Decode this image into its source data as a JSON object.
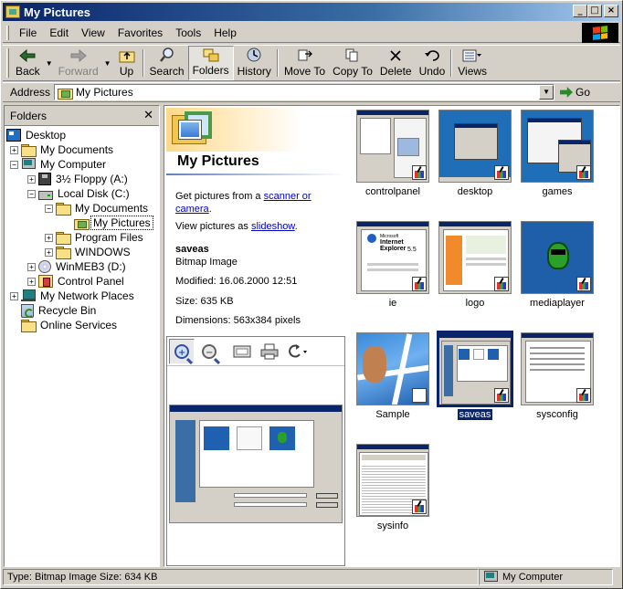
{
  "window": {
    "title": "My Pictures"
  },
  "menu": [
    "File",
    "Edit",
    "View",
    "Favorites",
    "Tools",
    "Help"
  ],
  "toolbar": {
    "back": "Back",
    "forward": "Forward",
    "up": "Up",
    "search": "Search",
    "folders": "Folders",
    "history": "History",
    "move_to": "Move To",
    "copy_to": "Copy To",
    "delete": "Delete",
    "undo": "Undo",
    "views": "Views"
  },
  "address": {
    "label": "Address",
    "value": "My Pictures",
    "go": "Go"
  },
  "folders_pane": {
    "title": "Folders",
    "tree": [
      {
        "label": "Desktop",
        "icon": "desktop-icon"
      },
      {
        "label": "My Documents",
        "icon": "folder-icon"
      },
      {
        "label": "My Computer",
        "icon": "computer-icon"
      },
      {
        "label": "3½ Floppy (A:)",
        "icon": "floppy-icon"
      },
      {
        "label": "Local Disk (C:)",
        "icon": "disk-icon"
      },
      {
        "label": "My Documents",
        "icon": "folder-icon"
      },
      {
        "label": "My Pictures",
        "icon": "pictures-folder-icon"
      },
      {
        "label": "Program Files",
        "icon": "folder-icon"
      },
      {
        "label": "WINDOWS",
        "icon": "folder-icon"
      },
      {
        "label": "WinMEB3 (D:)",
        "icon": "cd-icon"
      },
      {
        "label": "Control Panel",
        "icon": "control-panel-icon"
      },
      {
        "label": "My Network Places",
        "icon": "network-icon"
      },
      {
        "label": "Recycle Bin",
        "icon": "recycle-bin-icon"
      },
      {
        "label": "Online Services",
        "icon": "folder-icon"
      }
    ]
  },
  "webview": {
    "folder_title": "My Pictures",
    "intro_prefix": "Get pictures from a ",
    "intro_link": "scanner or camera",
    "intro_suffix": ".",
    "slideshow_prefix": "View pictures as ",
    "slideshow_link": "slideshow",
    "slideshow_suffix": ".",
    "file_name": "saveas",
    "file_type": "Bitmap Image",
    "modified": "Modified: 16.06.2000 12:51",
    "size": "Size: 635 KB",
    "dimensions": "Dimensions: 563x384 pixels"
  },
  "thumbnails": [
    {
      "name": "controlpanel"
    },
    {
      "name": "desktop"
    },
    {
      "name": "games"
    },
    {
      "name": "ie"
    },
    {
      "name": "logo"
    },
    {
      "name": "mediaplayer"
    },
    {
      "name": "Sample"
    },
    {
      "name": "saveas",
      "selected": true
    },
    {
      "name": "sysconfig"
    },
    {
      "name": "sysinfo"
    }
  ],
  "thumb_text": {
    "ie_brand_small": "Microsoft",
    "ie_brand": "Internet Explorer",
    "ie_version": "5.5"
  },
  "status": {
    "text": "Type: Bitmap Image Size: 634 KB",
    "zone": "My Computer"
  },
  "colors": {
    "titlebar": "#0a246a",
    "selection": "#0a246a",
    "link": "#0000cc",
    "face": "#d4d0c8"
  }
}
